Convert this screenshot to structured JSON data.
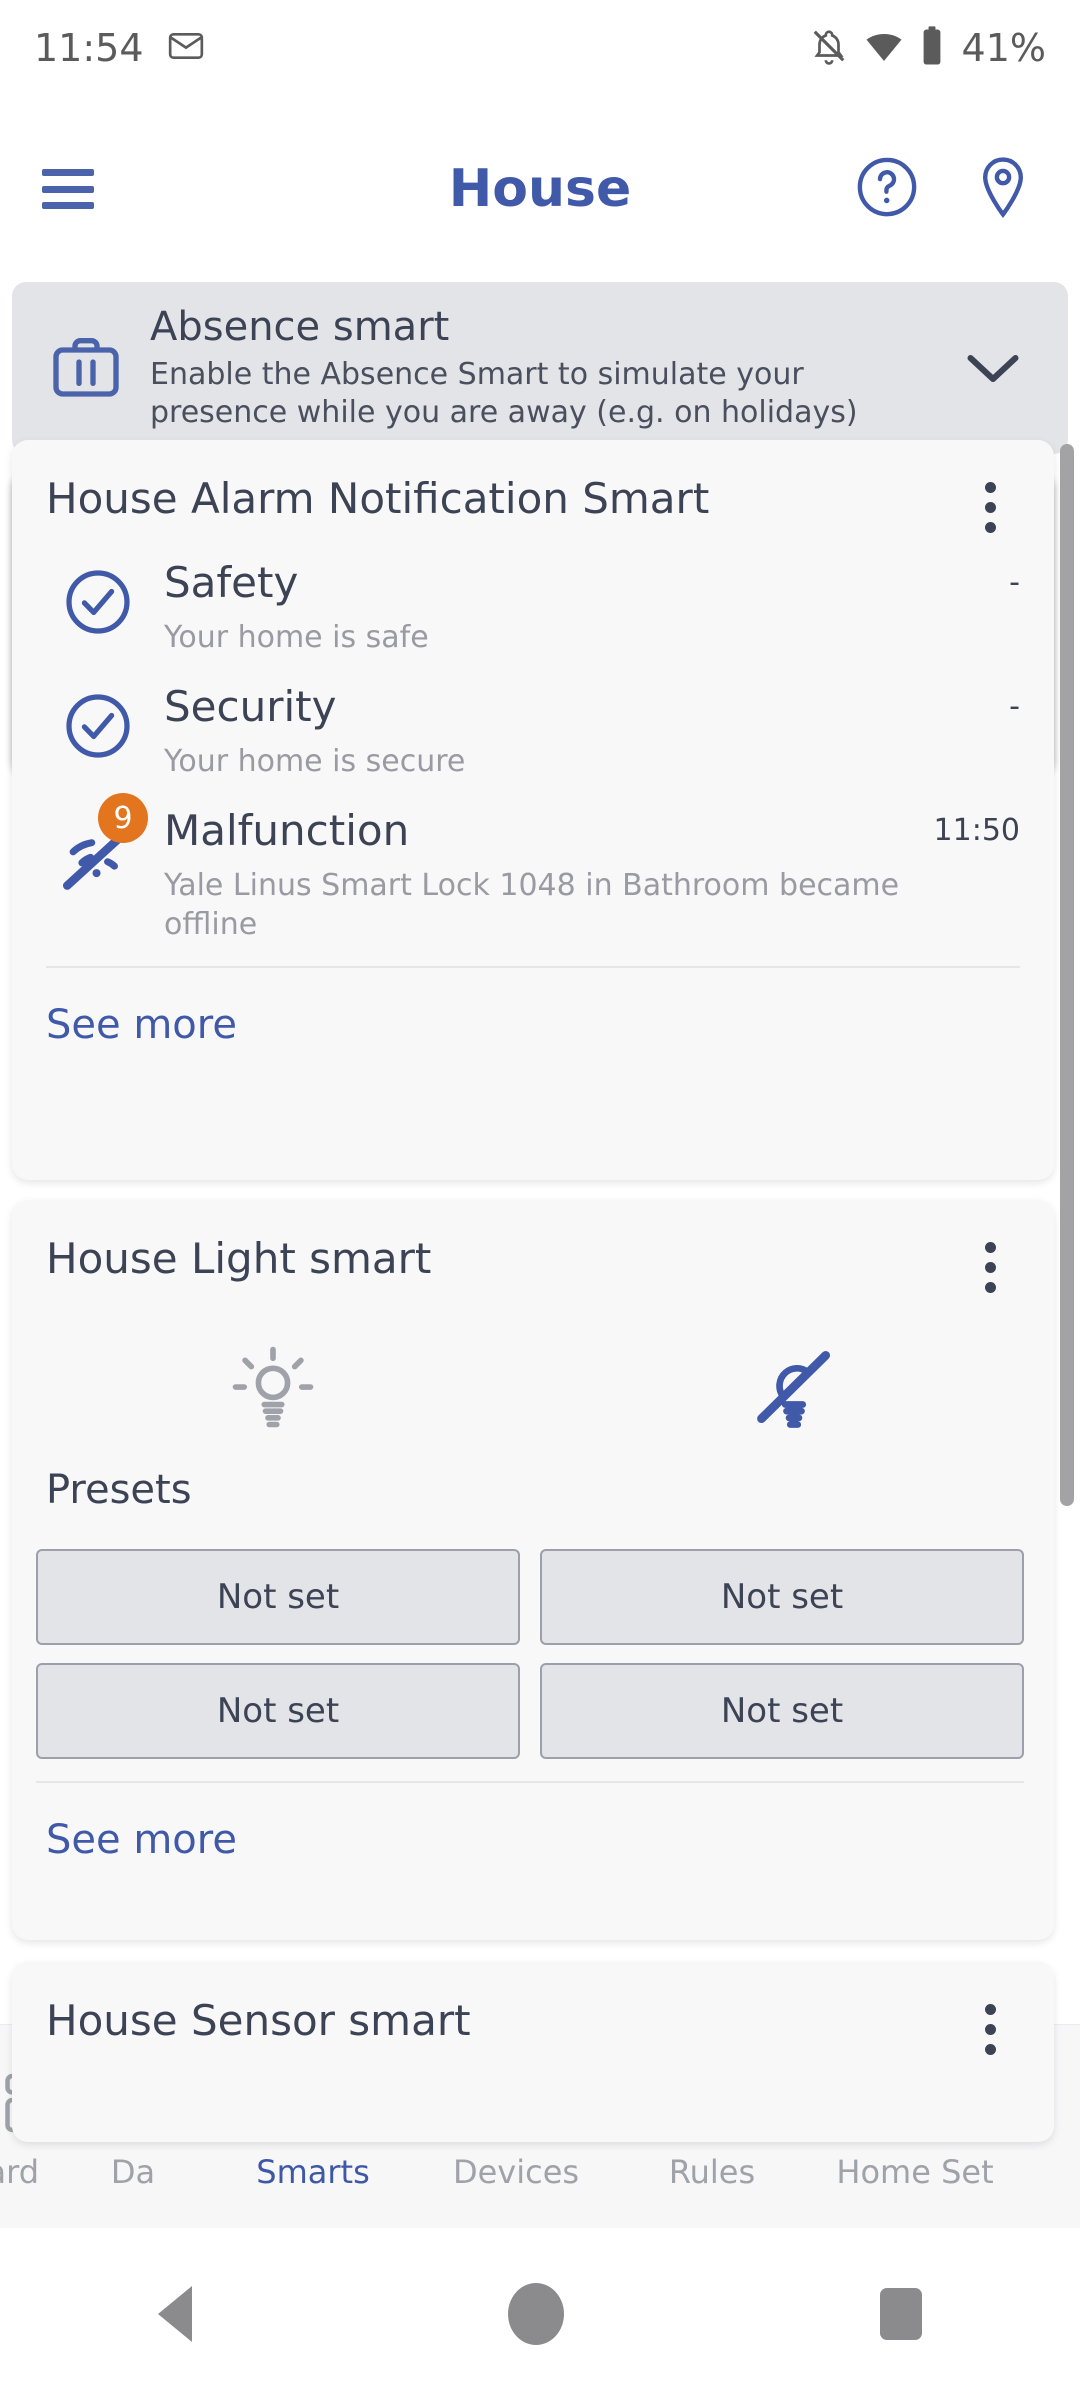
{
  "status_bar": {
    "time": "11:54",
    "mail_icon": "envelope-icon",
    "notifications_silenced_icon": "bell-off-icon",
    "wifi_icon": "wifi-icon",
    "battery_icon": "battery-icon",
    "battery_text": "41%"
  },
  "app_bar": {
    "menu_icon": "hamburger-menu-icon",
    "title": "House",
    "help_icon": "help-circle-icon",
    "location_icon": "location-pin-icon"
  },
  "absence_banner": {
    "icon": "suitcase-icon",
    "title": "Absence smart",
    "description": "Enable the Absence Smart to simulate your presence while you are away (e.g. on holidays)",
    "expand_icon": "chevron-down-icon"
  },
  "cards": [
    {
      "title": "House Alarm Notification Smart",
      "menu_icon": "kebab-menu-icon",
      "rows": [
        {
          "icon": "check-circle-icon",
          "name": "Safety",
          "description": "Your home is safe",
          "time": "-",
          "badge": ""
        },
        {
          "icon": "check-circle-icon",
          "name": "Security",
          "description": "Your home is secure",
          "time": "-",
          "badge": ""
        },
        {
          "icon": "wifi-off-icon",
          "name": "Malfunction",
          "description": "Yale Linus Smart Lock 1048 in Bathroom became offline",
          "time": "11:50",
          "badge": "9"
        }
      ],
      "see_more": "See more"
    },
    {
      "title": "House Light smart",
      "menu_icon": "kebab-menu-icon",
      "light_on_icon": "lightbulb-on-icon",
      "light_off_icon": "lightbulb-off-icon",
      "presets_label": "Presets",
      "presets": [
        "Not set",
        "Not set",
        "Not set",
        "Not set"
      ],
      "see_more": "See more"
    },
    {
      "title": "House Sensor smart",
      "menu_icon": "kebab-menu-icon"
    }
  ],
  "bottom_nav": [
    {
      "label": "oard",
      "icon": "dashboard-icon",
      "active": false
    },
    {
      "label": "Da",
      "icon": "data-icon",
      "active": false
    },
    {
      "label": "Smarts",
      "icon": "smarts-pin-icon",
      "active": true
    },
    {
      "label": "Devices",
      "icon": "devices-network-icon",
      "active": false
    },
    {
      "label": "Rules",
      "icon": "rules-lamp-icon",
      "active": false
    },
    {
      "label": "Home Set",
      "icon": "home-settings-icon",
      "active": false
    }
  ],
  "system_nav": {
    "back": "back-triangle-icon",
    "home": "home-circle-icon",
    "recents": "recents-square-icon"
  },
  "colors": {
    "accent_blue": "#4059a8",
    "badge_orange": "#e3751f",
    "card_bg": "#f8f8f9",
    "banner_bg": "#e3e4e8",
    "muted_text": "#9a9aa2",
    "primary_text": "#3c4355"
  }
}
